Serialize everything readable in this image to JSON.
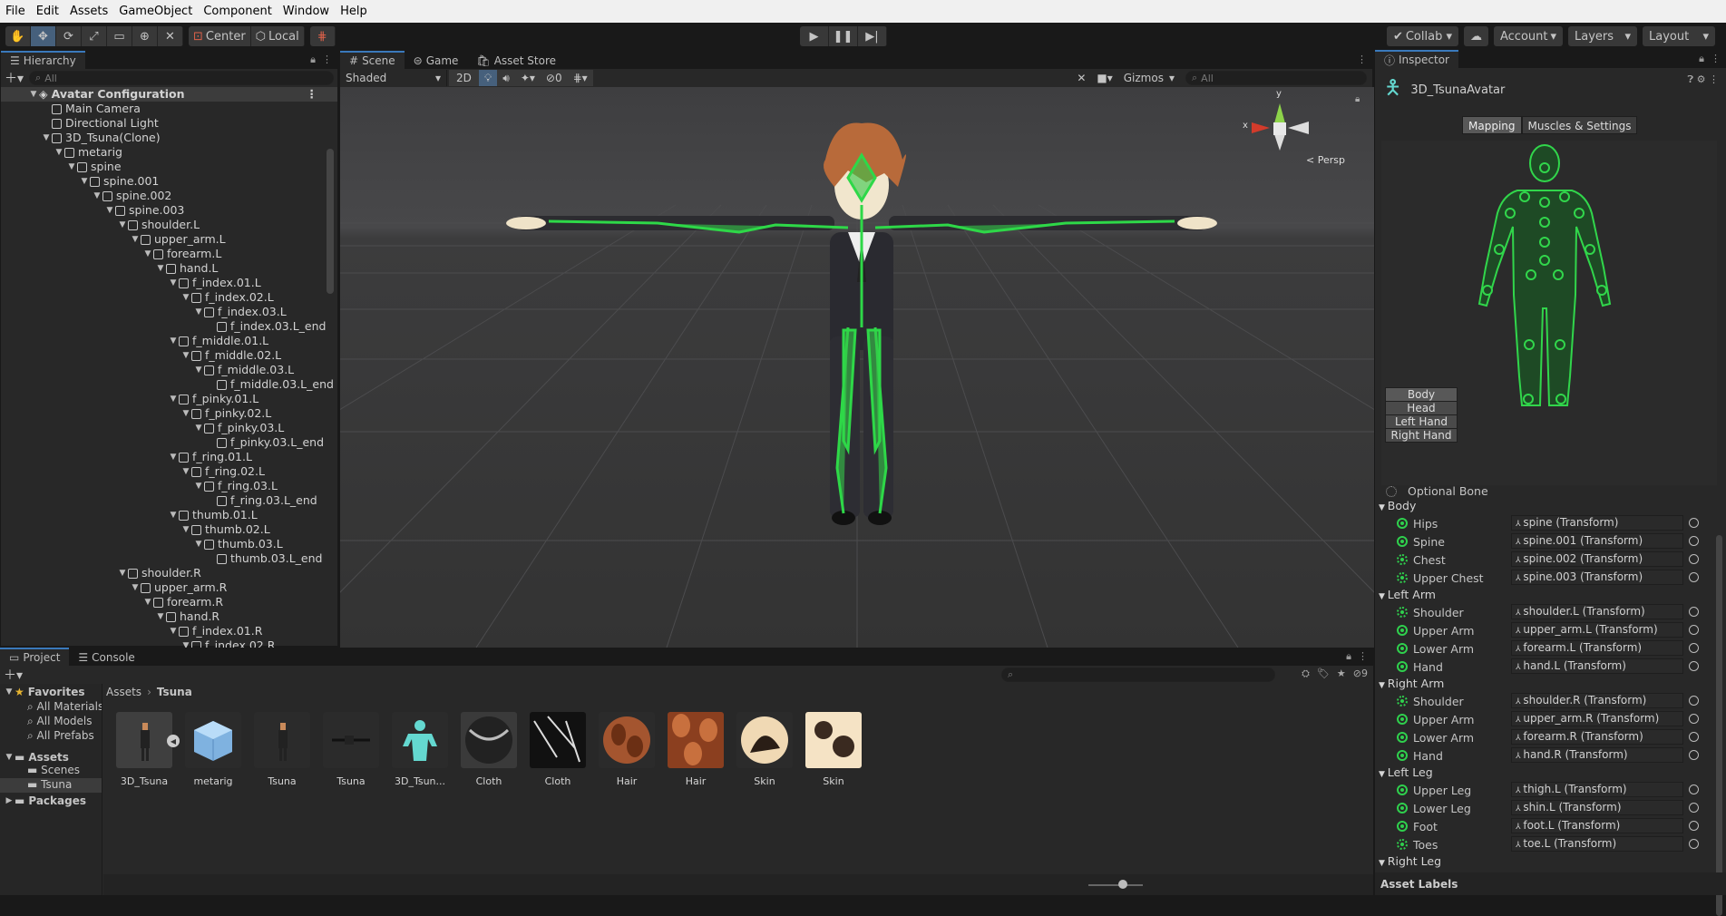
{
  "menubar": {
    "items": [
      "File",
      "Edit",
      "Assets",
      "GameObject",
      "Component",
      "Window",
      "Help"
    ]
  },
  "toolbar": {
    "center_label": "Center",
    "local_label": "Local",
    "collab_label": "Collab",
    "account_label": "Account",
    "layers_label": "Layers",
    "layout_label": "Layout"
  },
  "hierarchy": {
    "tab": "Hierarchy",
    "search_placeholder": "All",
    "root": "Avatar Configuration",
    "items": [
      {
        "label": "Main Camera",
        "depth": 1,
        "tri": false
      },
      {
        "label": "Directional Light",
        "depth": 1,
        "tri": false
      },
      {
        "label": "3D_Tsuna(Clone)",
        "depth": 1,
        "tri": true
      },
      {
        "label": "metarig",
        "depth": 2,
        "tri": true
      },
      {
        "label": "spine",
        "depth": 3,
        "tri": true
      },
      {
        "label": "spine.001",
        "depth": 4,
        "tri": true
      },
      {
        "label": "spine.002",
        "depth": 5,
        "tri": true
      },
      {
        "label": "spine.003",
        "depth": 6,
        "tri": true
      },
      {
        "label": "shoulder.L",
        "depth": 7,
        "tri": true
      },
      {
        "label": "upper_arm.L",
        "depth": 8,
        "tri": true
      },
      {
        "label": "forearm.L",
        "depth": 9,
        "tri": true
      },
      {
        "label": "hand.L",
        "depth": 10,
        "tri": true
      },
      {
        "label": "f_index.01.L",
        "depth": 11,
        "tri": true
      },
      {
        "label": "f_index.02.L",
        "depth": 12,
        "tri": true
      },
      {
        "label": "f_index.03.L",
        "depth": 13,
        "tri": true
      },
      {
        "label": "f_index.03.L_end",
        "depth": 14,
        "tri": false
      },
      {
        "label": "f_middle.01.L",
        "depth": 11,
        "tri": true
      },
      {
        "label": "f_middle.02.L",
        "depth": 12,
        "tri": true
      },
      {
        "label": "f_middle.03.L",
        "depth": 13,
        "tri": true
      },
      {
        "label": "f_middle.03.L_end",
        "depth": 14,
        "tri": false
      },
      {
        "label": "f_pinky.01.L",
        "depth": 11,
        "tri": true
      },
      {
        "label": "f_pinky.02.L",
        "depth": 12,
        "tri": true
      },
      {
        "label": "f_pinky.03.L",
        "depth": 13,
        "tri": true
      },
      {
        "label": "f_pinky.03.L_end",
        "depth": 14,
        "tri": false
      },
      {
        "label": "f_ring.01.L",
        "depth": 11,
        "tri": true
      },
      {
        "label": "f_ring.02.L",
        "depth": 12,
        "tri": true
      },
      {
        "label": "f_ring.03.L",
        "depth": 13,
        "tri": true
      },
      {
        "label": "f_ring.03.L_end",
        "depth": 14,
        "tri": false
      },
      {
        "label": "thumb.01.L",
        "depth": 11,
        "tri": true
      },
      {
        "label": "thumb.02.L",
        "depth": 12,
        "tri": true
      },
      {
        "label": "thumb.03.L",
        "depth": 13,
        "tri": true
      },
      {
        "label": "thumb.03.L_end",
        "depth": 14,
        "tri": false
      },
      {
        "label": "shoulder.R",
        "depth": 7,
        "tri": true
      },
      {
        "label": "upper_arm.R",
        "depth": 8,
        "tri": true
      },
      {
        "label": "forearm.R",
        "depth": 9,
        "tri": true
      },
      {
        "label": "hand.R",
        "depth": 10,
        "tri": true
      },
      {
        "label": "f_index.01.R",
        "depth": 11,
        "tri": true
      },
      {
        "label": "f_index.02.R",
        "depth": 12,
        "tri": true
      }
    ]
  },
  "scene": {
    "tabs": [
      "Scene",
      "Game",
      "Asset Store"
    ],
    "shading": "Shaded",
    "mode_2d": "2D",
    "hidden_count": "0",
    "gizmos": "Gizmos",
    "search_placeholder": "All",
    "persp_label": "Persp",
    "axis_x": "x",
    "axis_y": "y"
  },
  "inspector": {
    "tab": "Inspector",
    "object_name": "3D_TsunaAvatar",
    "tabs": [
      "Mapping",
      "Muscles & Settings"
    ],
    "body_buttons": [
      "Body",
      "Head",
      "Left Hand",
      "Right Hand"
    ],
    "optional_bone": "Optional Bone",
    "sections": [
      {
        "title": "Body",
        "rows": [
          {
            "label": "Hips",
            "value": "spine (Transform)",
            "dashed": false
          },
          {
            "label": "Spine",
            "value": "spine.001 (Transform)",
            "dashed": false
          },
          {
            "label": "Chest",
            "value": "spine.002 (Transform)",
            "dashed": true
          },
          {
            "label": "Upper Chest",
            "value": "spine.003 (Transform)",
            "dashed": true
          }
        ]
      },
      {
        "title": "Left Arm",
        "rows": [
          {
            "label": "Shoulder",
            "value": "shoulder.L (Transform)",
            "dashed": true
          },
          {
            "label": "Upper Arm",
            "value": "upper_arm.L (Transform)",
            "dashed": false
          },
          {
            "label": "Lower Arm",
            "value": "forearm.L (Transform)",
            "dashed": false
          },
          {
            "label": "Hand",
            "value": "hand.L (Transform)",
            "dashed": false
          }
        ]
      },
      {
        "title": "Right Arm",
        "rows": [
          {
            "label": "Shoulder",
            "value": "shoulder.R (Transform)",
            "dashed": true
          },
          {
            "label": "Upper Arm",
            "value": "upper_arm.R (Transform)",
            "dashed": false
          },
          {
            "label": "Lower Arm",
            "value": "forearm.R (Transform)",
            "dashed": false
          },
          {
            "label": "Hand",
            "value": "hand.R (Transform)",
            "dashed": false
          }
        ]
      },
      {
        "title": "Left Leg",
        "rows": [
          {
            "label": "Upper Leg",
            "value": "thigh.L (Transform)",
            "dashed": false
          },
          {
            "label": "Lower Leg",
            "value": "shin.L (Transform)",
            "dashed": false
          },
          {
            "label": "Foot",
            "value": "foot.L (Transform)",
            "dashed": false
          },
          {
            "label": "Toes",
            "value": "toe.L (Transform)",
            "dashed": true
          }
        ]
      },
      {
        "title": "Right Leg",
        "rows": []
      }
    ],
    "asset_labels": "Asset Labels"
  },
  "project": {
    "tabs": [
      "Project",
      "Console"
    ],
    "count_badge": "9",
    "favorites": "Favorites",
    "favorite_items": [
      "All Materials",
      "All Models",
      "All Prefabs"
    ],
    "assets_root": "Assets",
    "asset_folders": [
      "Scenes",
      "Tsuna"
    ],
    "packages": "Packages",
    "breadcrumb": [
      "Assets",
      "Tsuna"
    ],
    "assets": [
      {
        "label": "3D_Tsuna",
        "kind": "model"
      },
      {
        "label": "metarig",
        "kind": "mesh"
      },
      {
        "label": "Tsuna",
        "kind": "model"
      },
      {
        "label": "Tsuna",
        "kind": "rig"
      },
      {
        "label": "3D_Tsun...",
        "kind": "avatar"
      },
      {
        "label": "Cloth",
        "kind": "cloth1"
      },
      {
        "label": "Cloth",
        "kind": "cloth2"
      },
      {
        "label": "Hair",
        "kind": "hair1"
      },
      {
        "label": "Hair",
        "kind": "hair2"
      },
      {
        "label": "Skin",
        "kind": "skin1"
      },
      {
        "label": "Skin",
        "kind": "skin2"
      }
    ]
  }
}
